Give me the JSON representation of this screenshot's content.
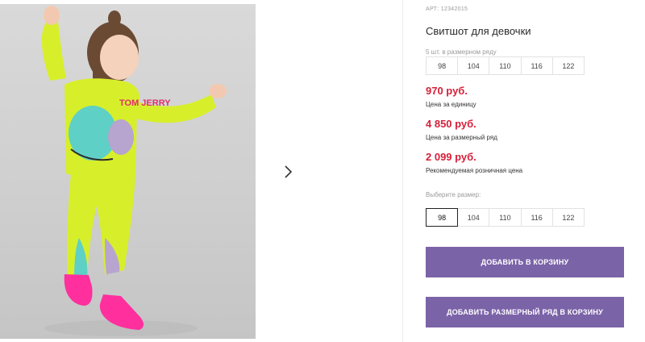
{
  "product": {
    "sku_label": "АРТ: 12342015",
    "title": "Свитшот для девочки",
    "row_caption": "5 шт. в размерном ряду",
    "row_sizes": [
      "98",
      "104",
      "110",
      "116",
      "122"
    ],
    "prices": [
      {
        "value": "970 руб.",
        "label": "Цена за единицу"
      },
      {
        "value": "4 850 руб.",
        "label": "Цена за размерный ряд"
      },
      {
        "value": "2 099 руб.",
        "label": "Рекомендуемая розничная цена"
      }
    ],
    "choose_caption": "Выберите размер:",
    "pick_sizes": [
      "98",
      "104",
      "110",
      "116",
      "122"
    ],
    "selected_size": "98",
    "add_to_cart": "ДОБАВИТЬ В КОРЗИНУ",
    "add_row_to_cart": "ДОБАВИТЬ РАЗМЕРНЫЙ РЯД В КОРЗИНУ"
  },
  "gallery": {
    "next_icon": "chevron-right-icon",
    "photo_print_text": "TOM JERRY"
  },
  "colors": {
    "price": "#d5203a",
    "button": "#7b63a8",
    "outfit": "#d7ef2a",
    "shoes": "#ff2f9e",
    "photo_bg": "#d2d2d2"
  }
}
